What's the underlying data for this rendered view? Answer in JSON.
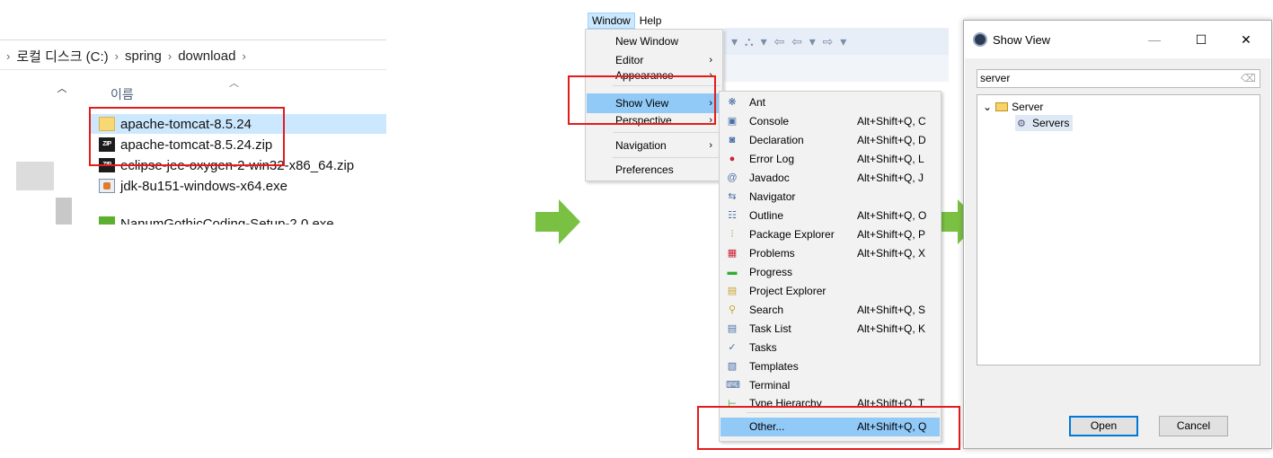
{
  "explorer": {
    "breadcrumb": [
      "로컬 디스크 (C:)",
      "spring",
      "download"
    ],
    "breadcrumb_sep": "›",
    "column_header": "이름",
    "files": [
      {
        "name": "apache-tomcat-8.5.24",
        "icon": "folder-icon",
        "selected": true
      },
      {
        "name": "apache-tomcat-8.5.24.zip",
        "icon": "zip-icon",
        "selected": false
      },
      {
        "name": "eclipse-jee-oxygen-2-win32-x86_64.zip",
        "icon": "zip-icon",
        "selected": false
      },
      {
        "name": "jdk-8u151-windows-x64.exe",
        "icon": "installer-icon",
        "selected": false
      },
      {
        "name": "NanumGothicCoding-Setup-2.0.exe",
        "icon": "installer-icon",
        "selected": false
      }
    ],
    "zip_icon_text": "ZIP"
  },
  "menubar": {
    "items": [
      "Window",
      "Help"
    ]
  },
  "window_menu": {
    "items": [
      {
        "label": "New Window",
        "submenu": false
      },
      {
        "label": "Editor",
        "submenu": true
      },
      {
        "label": "Appearance",
        "submenu": true
      },
      {
        "label": "Show View",
        "submenu": true,
        "highlighted": true
      },
      {
        "label": "Perspective",
        "submenu": true
      },
      {
        "label": "Navigation",
        "submenu": true
      },
      {
        "label": "Preferences",
        "submenu": false
      }
    ]
  },
  "show_view_menu": {
    "items": [
      {
        "label": "Ant",
        "shortcut": "",
        "icon": "ant-icon"
      },
      {
        "label": "Console",
        "shortcut": "Alt+Shift+Q, C",
        "icon": "console-icon"
      },
      {
        "label": "Declaration",
        "shortcut": "Alt+Shift+Q, D",
        "icon": "declaration-icon"
      },
      {
        "label": "Error Log",
        "shortcut": "Alt+Shift+Q, L",
        "icon": "error-log-icon"
      },
      {
        "label": "Javadoc",
        "shortcut": "Alt+Shift+Q, J",
        "icon": "javadoc-icon"
      },
      {
        "label": "Navigator",
        "shortcut": "",
        "icon": "navigator-icon"
      },
      {
        "label": "Outline",
        "shortcut": "Alt+Shift+Q, O",
        "icon": "outline-icon"
      },
      {
        "label": "Package Explorer",
        "shortcut": "Alt+Shift+Q, P",
        "icon": "package-explorer-icon"
      },
      {
        "label": "Problems",
        "shortcut": "Alt+Shift+Q, X",
        "icon": "problems-icon"
      },
      {
        "label": "Progress",
        "shortcut": "",
        "icon": "progress-icon"
      },
      {
        "label": "Project Explorer",
        "shortcut": "",
        "icon": "project-explorer-icon"
      },
      {
        "label": "Search",
        "shortcut": "Alt+Shift+Q, S",
        "icon": "search-icon"
      },
      {
        "label": "Task List",
        "shortcut": "Alt+Shift+Q, K",
        "icon": "task-list-icon"
      },
      {
        "label": "Tasks",
        "shortcut": "",
        "icon": "tasks-icon"
      },
      {
        "label": "Templates",
        "shortcut": "",
        "icon": "templates-icon"
      },
      {
        "label": "Terminal",
        "shortcut": "",
        "icon": "terminal-icon"
      },
      {
        "label": "Type Hierarchy",
        "shortcut": "Alt+Shift+Q, T",
        "icon": "type-hierarchy-icon"
      },
      {
        "label": "Other...",
        "shortcut": "Alt+Shift+Q, Q",
        "icon": "",
        "highlighted": true
      }
    ]
  },
  "dialog": {
    "title": "Show View",
    "filter_value": "server",
    "tree": {
      "category": "Server",
      "child": "Servers"
    },
    "buttons": {
      "open": "Open",
      "cancel": "Cancel"
    },
    "window_controls": {
      "minimize": "—",
      "maximize": "☐",
      "close": "✕"
    }
  },
  "colors": {
    "highlight_box": "#e41b1b",
    "arrow": "#7ac143",
    "menu_highlight": "#91c9f7",
    "explorer_selection": "#cce8ff"
  }
}
